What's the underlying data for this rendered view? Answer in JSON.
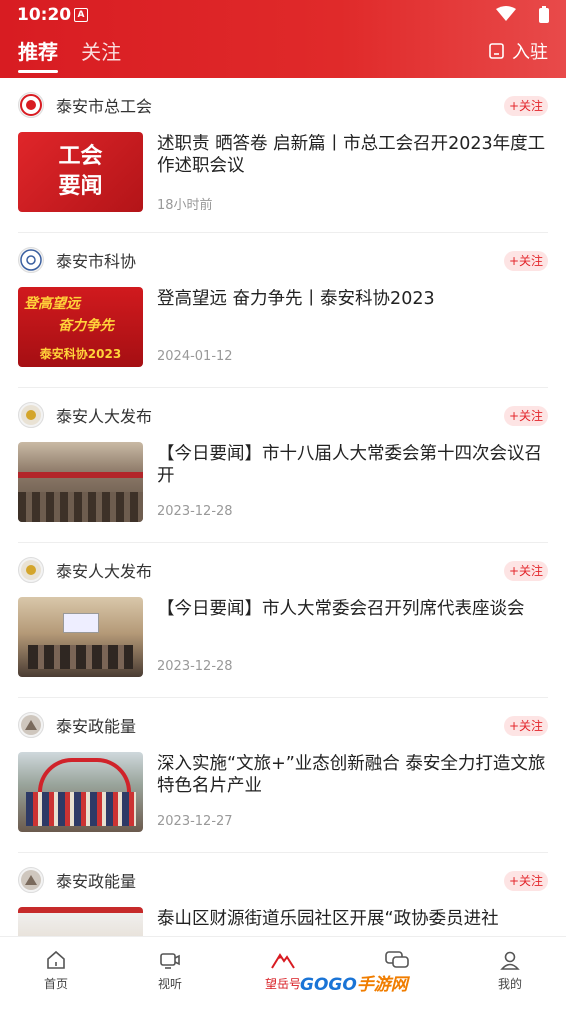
{
  "status": {
    "time": "10:20",
    "a_icon": "A"
  },
  "header": {
    "tabs": [
      {
        "label": "推荐",
        "active": true
      },
      {
        "label": "关注",
        "active": false
      }
    ],
    "join_label": "入驻"
  },
  "feed": [
    {
      "source": "泰安市总工会",
      "follow": "+关注",
      "title": "述职责 晒答卷 启新篇丨市总工会召开2023年度工作述职会议",
      "time": "18小时前",
      "thumb_text": [
        "工会",
        "要闻"
      ]
    },
    {
      "source": "泰安市科协",
      "follow": "+关注",
      "title": "登高望远 奋力争先丨泰安科协2023",
      "time": "2024-01-12",
      "thumb_text": [
        "登高望远",
        "奋力争先",
        "泰安科协2023"
      ]
    },
    {
      "source": "泰安人大发布",
      "follow": "+关注",
      "title": "【今日要闻】市十八届人大常委会第十四次会议召开",
      "time": "2023-12-28"
    },
    {
      "source": "泰安人大发布",
      "follow": "+关注",
      "title": "【今日要闻】市人大常委会召开列席代表座谈会",
      "time": "2023-12-28"
    },
    {
      "source": "泰安政能量",
      "follow": "+关注",
      "title": "深入实施“文旅+”业态创新融合 泰安全力打造文旅特色名片产业",
      "time": "2023-12-27"
    },
    {
      "source": "泰安政能量",
      "follow": "+关注",
      "title": "泰山区财源街道乐园社区开展“政协委员进社",
      "time": ""
    }
  ],
  "tabbar": [
    {
      "label": "首页",
      "icon": "home-icon"
    },
    {
      "label": "视听",
      "icon": "video-icon"
    },
    {
      "label": "望岳号",
      "icon": "mountain-icon",
      "active": true
    },
    {
      "label": "",
      "icon": "chat-icon"
    },
    {
      "label": "我的",
      "icon": "user-icon"
    }
  ],
  "watermark": {
    "main": "GOGO",
    "sub": "手游网"
  },
  "colors": {
    "brand": "#d81c22",
    "follow_bg": "#fde4e4"
  }
}
